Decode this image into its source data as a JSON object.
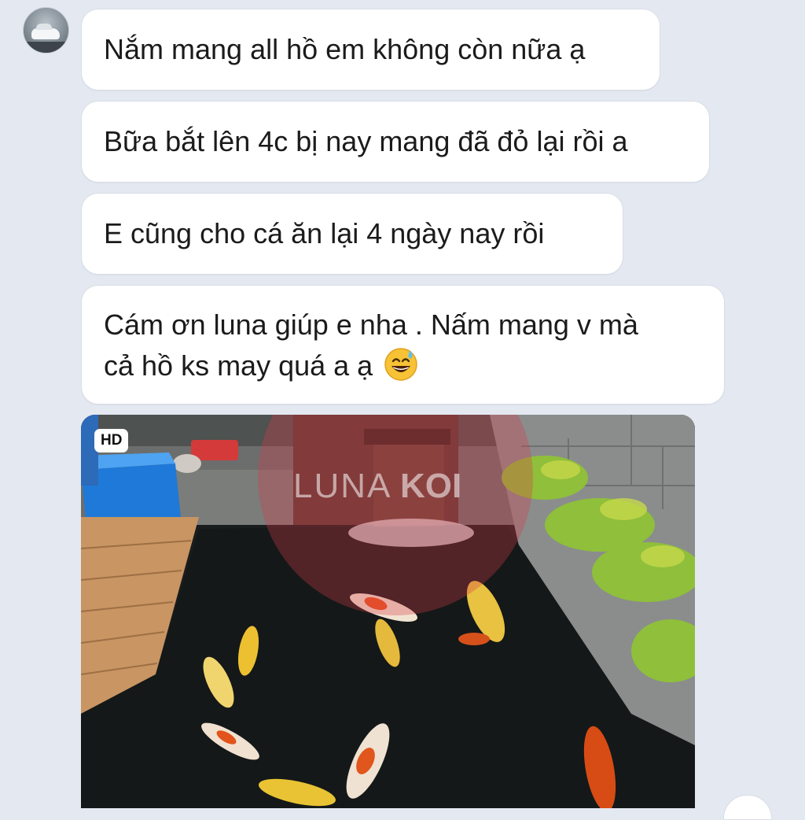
{
  "chat": {
    "avatar_icon": "profile-avatar-car",
    "messages": [
      {
        "lines": [
          "Nắm mang all hồ em không còn nữa ạ"
        ]
      },
      {
        "lines": [
          "Bữa bắt lên 4c bị nay mang đã đỏ lại rồi a"
        ]
      },
      {
        "lines": [
          "E cũng cho cá ăn lại 4 ngày nay rồi"
        ]
      },
      {
        "lines": [
          "Cám ơn luna giúp e nha . Nấm mang v mà",
          "cả hồ ks may quá a ạ"
        ],
        "emoji": "grinning-sweat-emoji"
      }
    ],
    "photo": {
      "badge": "HD",
      "watermark_left": "LUNA",
      "watermark_right": "KOI",
      "description_icon": "koi-pond-photo"
    }
  },
  "colors": {
    "background": "#e4e8f1",
    "bubble": "#ffffff",
    "text": "#1b1b1b",
    "watermark": "#d63a48"
  }
}
